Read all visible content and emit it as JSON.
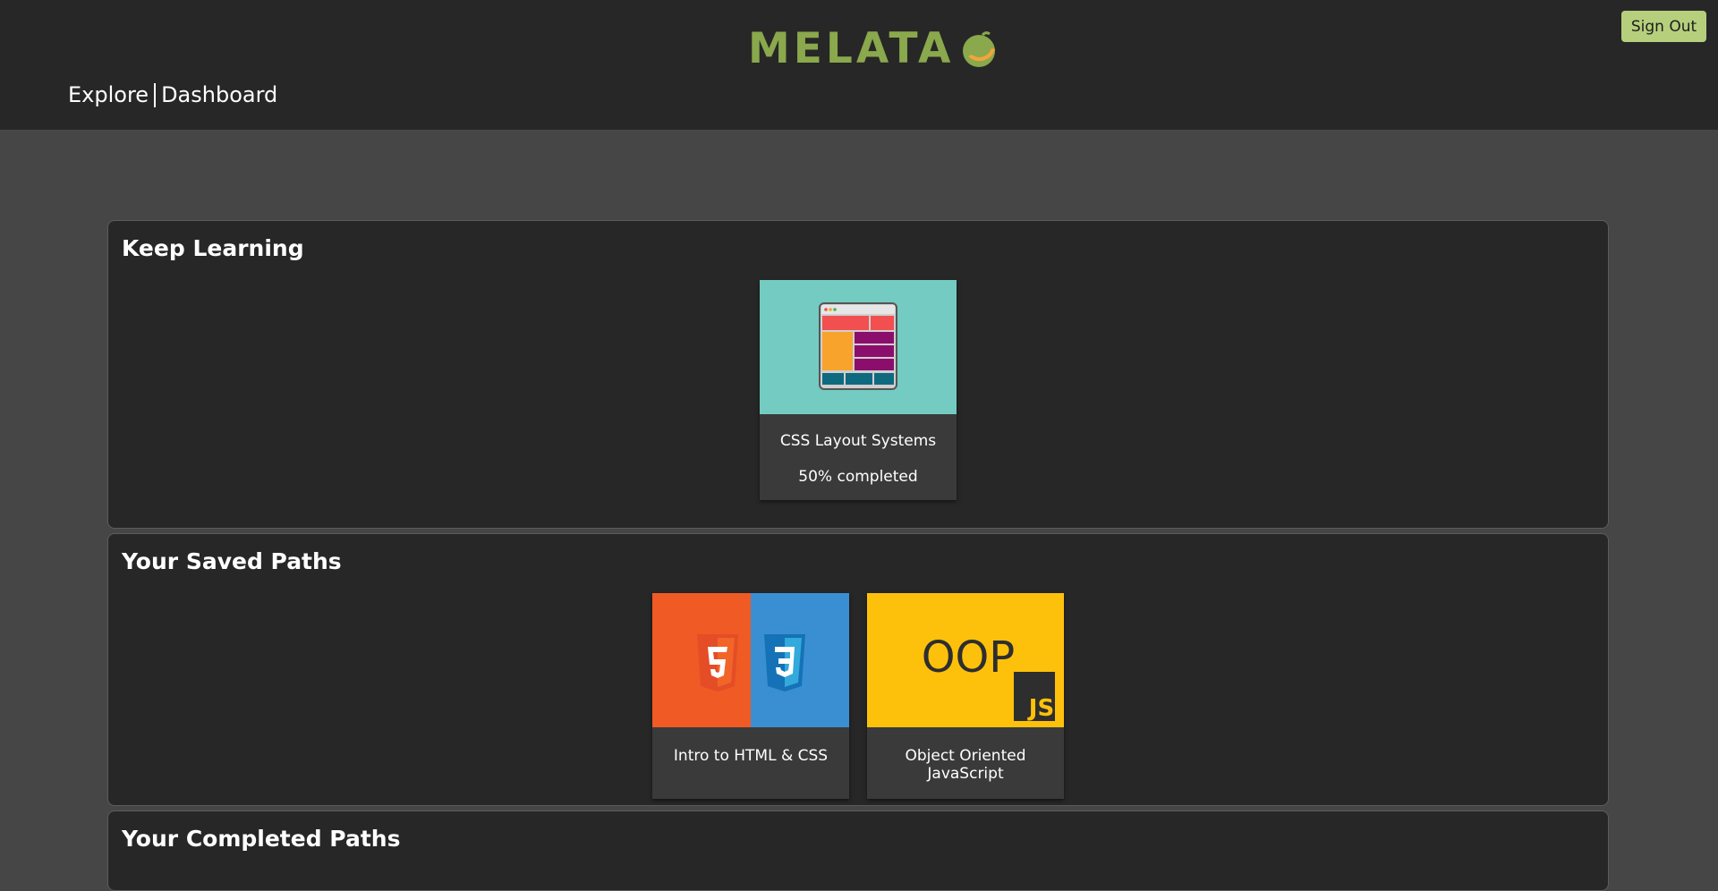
{
  "header": {
    "logo_text": "MELATA",
    "nav": {
      "explore": "Explore",
      "dashboard": "Dashboard"
    },
    "sign_out": "Sign Out"
  },
  "sections": {
    "keep_learning": {
      "title": "Keep Learning",
      "cards": [
        {
          "title": "CSS Layout Systems",
          "progress": "50% completed",
          "image_icon": "css-layout-grid-icon"
        }
      ]
    },
    "saved_paths": {
      "title": "Your Saved Paths",
      "cards": [
        {
          "title": "Intro to HTML & CSS",
          "image_icon": "html5-css3-icon"
        },
        {
          "title": "Object Oriented JavaScript",
          "image_icon": "oop-js-icon",
          "image_text": "OOP",
          "badge_text": "JS"
        }
      ]
    },
    "completed_paths": {
      "title": "Your Completed Paths"
    }
  },
  "colors": {
    "brand": "#8aa84c",
    "accent": "#b6cf7c",
    "header_bg": "#272727",
    "page_bg": "#464646"
  }
}
